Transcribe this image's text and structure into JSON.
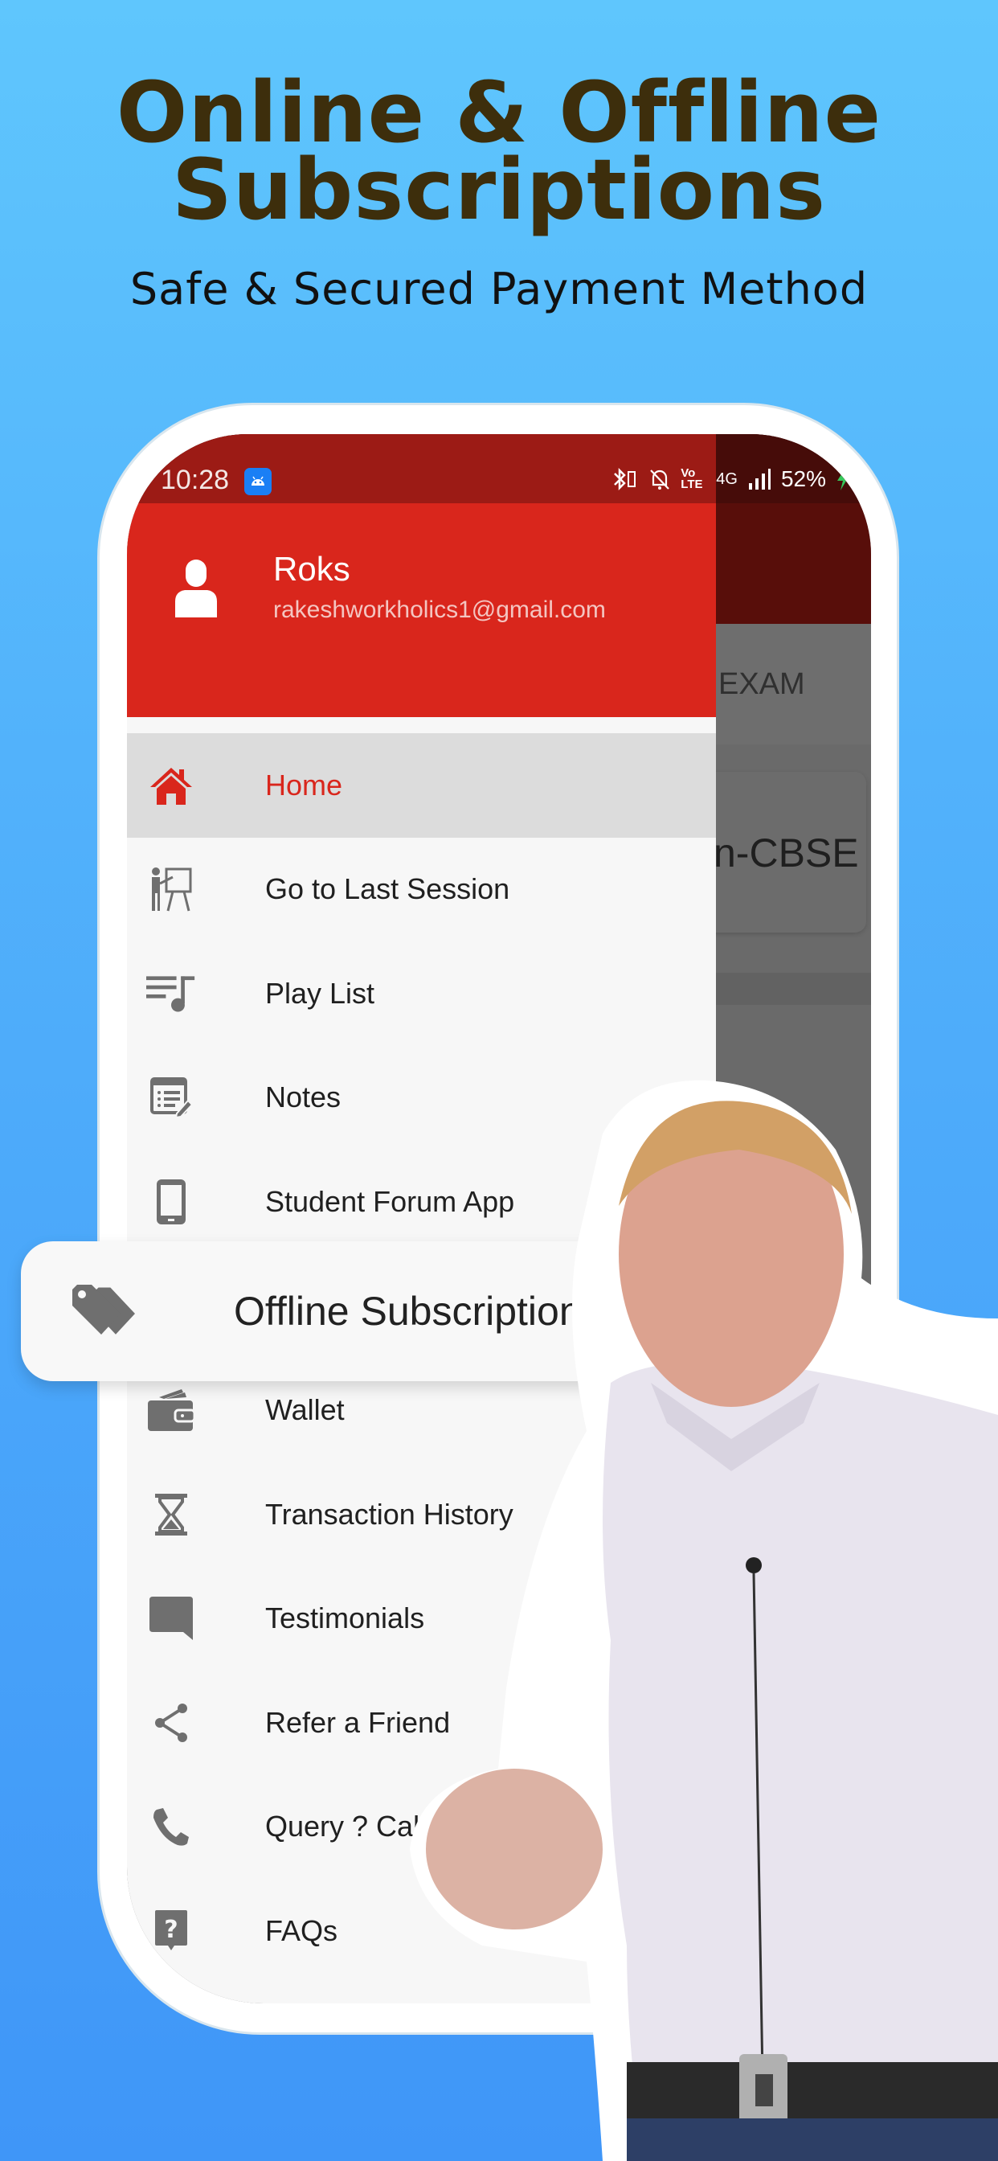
{
  "promo": {
    "headline_line1": "Online & Offline",
    "headline_line2": "Subscriptions",
    "subheadline": "Safe & Secured Payment Method"
  },
  "status_bar": {
    "time": "10:28",
    "network": "4G",
    "volte": "Vo LTE",
    "battery": "52%",
    "icons": [
      "android-app-icon",
      "bluetooth-icon",
      "notifications-off-icon",
      "volte-icon",
      "signal-icon",
      "charging-icon"
    ]
  },
  "background_app": {
    "tab_label": "EXAM",
    "card_text": "n-CBSE"
  },
  "drawer": {
    "user": {
      "name": "Roks",
      "email": "rakeshworkholics1@gmail.com"
    },
    "items": [
      {
        "label": "Home",
        "icon": "home-icon",
        "active": true
      },
      {
        "label": "Go to Last Session",
        "icon": "presentation-icon",
        "active": false
      },
      {
        "label": "Play List",
        "icon": "playlist-icon",
        "active": false
      },
      {
        "label": "Notes",
        "icon": "notes-icon",
        "active": false
      },
      {
        "label": "Student Forum App",
        "icon": "smartphone-icon",
        "active": false
      },
      {
        "label": "Offline Subscription",
        "icon": "tag-icon",
        "active": false
      },
      {
        "label": "Wallet",
        "icon": "wallet-icon",
        "active": false
      },
      {
        "label": "Transaction History",
        "icon": "hourglass-icon",
        "active": false
      },
      {
        "label": "Testimonials",
        "icon": "chat-bubble-icon",
        "active": false
      },
      {
        "label": "Refer a Friend",
        "icon": "share-icon",
        "active": false
      },
      {
        "label": "Query ? Call",
        "icon": "phone-icon",
        "active": false
      },
      {
        "label": "FAQs",
        "icon": "help-icon",
        "active": false
      }
    ]
  },
  "callout": {
    "label": "Offline Subscription",
    "icon": "tag-icon"
  },
  "colors": {
    "accent_red": "#d9261c",
    "status_bar_red": "#9c1b15",
    "headline_brown": "#3d2e0c",
    "icon_gray": "#6f6f6f",
    "background_blue": "#52b2fb"
  }
}
